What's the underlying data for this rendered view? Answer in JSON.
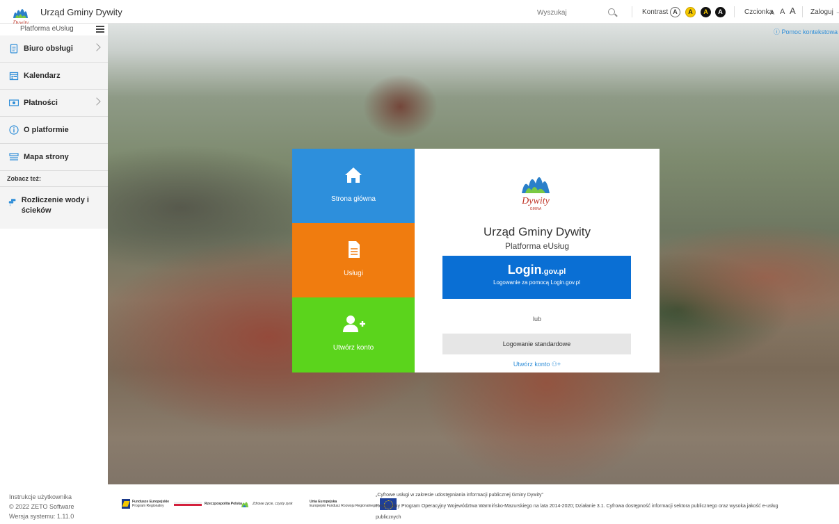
{
  "header": {
    "app_title": "Urząd Gminy Dywity",
    "platform_label": "Platforma eUsług",
    "search_placeholder": "Wyszukaj",
    "contrast_label": "Kontrast",
    "contrast_options": [
      "A",
      "A",
      "A",
      "A"
    ],
    "font_label": "Czcionka",
    "font_options": [
      "A",
      "A",
      "A"
    ],
    "login_label": "Zaloguj",
    "login_icon": "login-arrow-icon",
    "accent_color": "#2f8ed8"
  },
  "logo": {
    "text": "Dywity",
    "subtext": "GMINA"
  },
  "sidebar": {
    "items": [
      {
        "label": "Biuro obsługi",
        "icon": "document-icon",
        "has_submenu": true
      },
      {
        "label": "Kalendarz",
        "icon": "calendar-icon",
        "has_submenu": false
      },
      {
        "label": "Płatności",
        "icon": "payment-icon",
        "has_submenu": true
      },
      {
        "label": "O platformie",
        "icon": "info-icon",
        "has_submenu": false
      },
      {
        "label": "Mapa strony",
        "icon": "sitemap-icon",
        "has_submenu": false
      }
    ],
    "see_also_label": "Zobacz też:",
    "related": {
      "label": "Rozliczenie wody i ścieków",
      "icon": "water-tap-icon"
    }
  },
  "help_link": "Pomoc kontekstowa",
  "tiles": {
    "home": {
      "label": "Strona główna",
      "icon": "home-icon",
      "color": "#2d8fdc"
    },
    "services": {
      "label": "Usługi",
      "icon": "file-icon",
      "color": "#f07c0f"
    },
    "account": {
      "label": "Utwórz konto",
      "icon": "add-user-icon",
      "color": "#5bd41c"
    }
  },
  "panel": {
    "title": "Urząd Gminy Dywity",
    "subtitle": "Platforma eUsług",
    "logingov_main": "Login",
    "logingov_domain": ".gov.pl",
    "logingov_desc": "Logowanie za pomocą Login.gov.pl",
    "or_text": "lub",
    "standard_login": "Logowanie standardowe",
    "create_account": "Utwórz konto"
  },
  "footer_left": {
    "manual": "Instrukcje użytkownika",
    "copyright": "© 2022 ZETO Software",
    "version": "Wersja systemu: 1.11.0"
  },
  "footer_logos": {
    "fe_title": "Fundusze Europejskie",
    "fe_sub": "Program Regionalny",
    "rp_title": "Rzeczpospolita Polska",
    "wm_caption": "Zdrowe życie, czysty zysk",
    "ue_title": "Unia Europejska",
    "ue_sub": "Europejski Fundusz Rozwoju Regionalnego"
  },
  "footer_note": {
    "line1": "„Cyfrowe usługi w zakresie udostępniania informacji publicznej Gminy Dywity”",
    "line2": "Regionalny Program Operacyjny Województwa Warmińsko-Mazurskiego na lata 2014-2020; Działanie 3.1. Cyfrowa dostępność informacji sektora publicznego oraz wysoka jakość e-usług",
    "line3": "publicznych"
  }
}
